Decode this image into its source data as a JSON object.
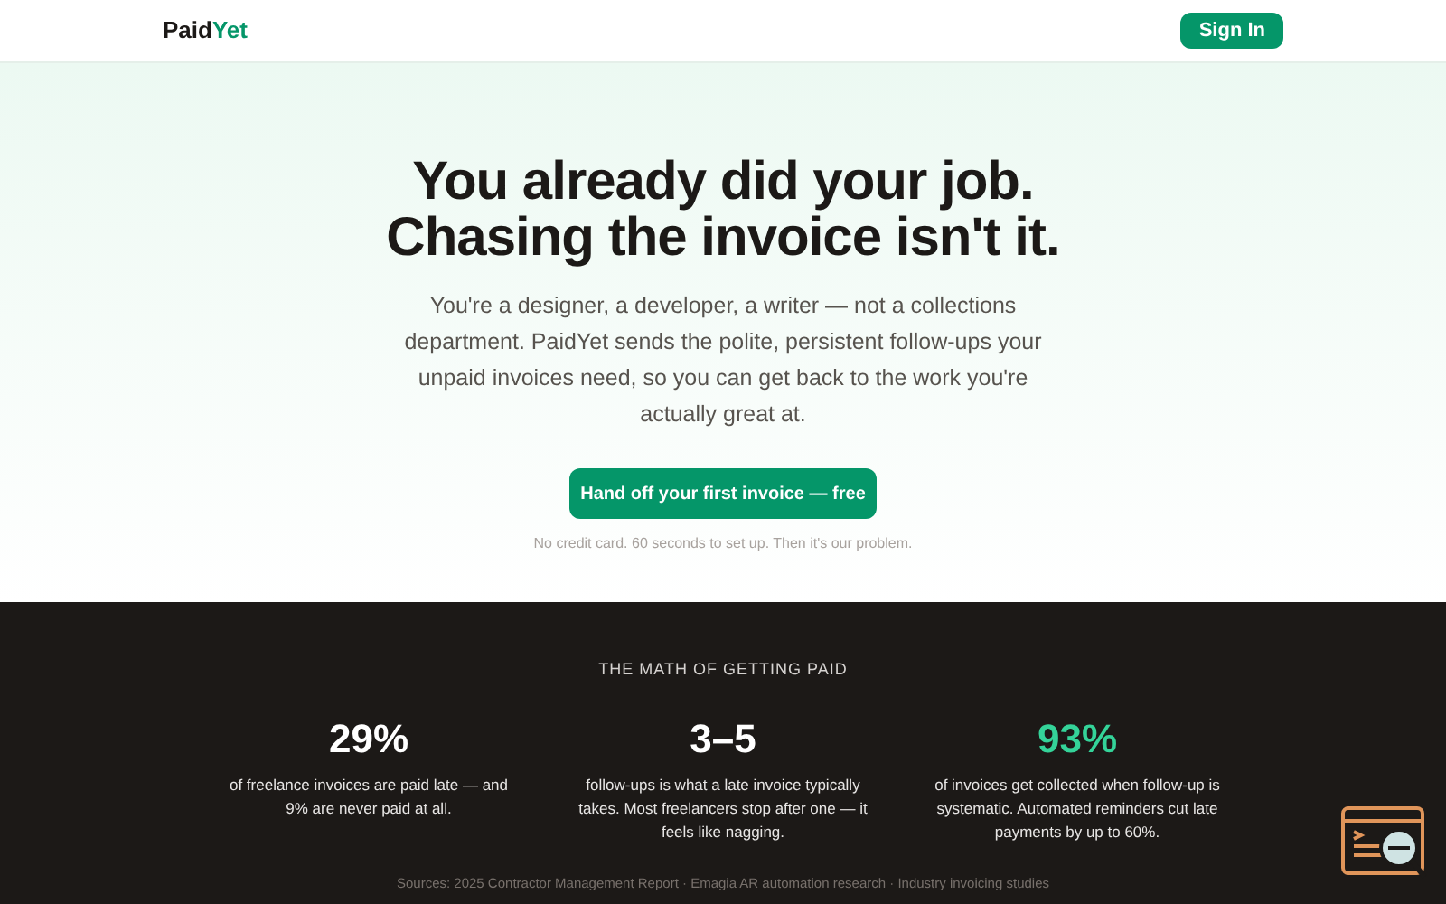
{
  "header": {
    "logo": [
      "Paid",
      "Yet"
    ],
    "sign_in": "Sign In"
  },
  "hero": {
    "title_lines": [
      "You already did your job.",
      "Chasing the invoice isn't it."
    ],
    "body": "You're a designer, a developer, a writer — not a collections department. PaidYet sends the polite, persistent follow-ups your unpaid invoices need, so you can get back to the work you're actually great at.",
    "cta": "Hand off your first invoice — free",
    "note": "No credit card. 60 seconds to set up. Then it's our problem."
  },
  "stats": {
    "heading": "THE MATH OF GETTING PAID",
    "items": [
      {
        "value": "29%",
        "color": "#ffffff",
        "text": "of freelance invoices are paid late — and 9% are never paid at all."
      },
      {
        "value": "3–5",
        "color": "#ffffff",
        "text": "follow-ups is what a late invoice typically takes. Most freelancers stop after one — it feels like nagging."
      },
      {
        "value": "93%",
        "color": "#34d399",
        "text": "of invoices get collected when follow-up is systematic. Automated reminders cut late payments by up to 60%."
      }
    ],
    "sources": "Sources: 2025 Contractor Management Report · Emagia AR automation research · Industry invoicing studies"
  }
}
